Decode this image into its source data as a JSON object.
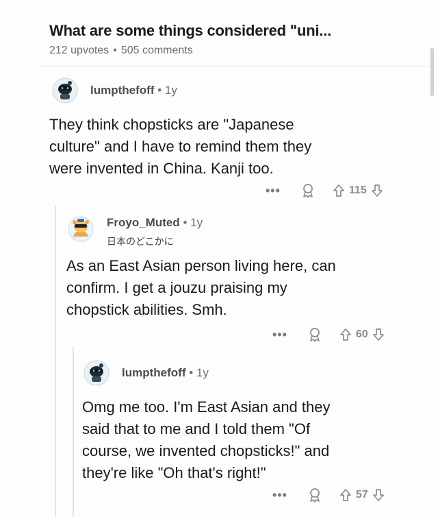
{
  "post": {
    "title": "What are some things considered \"uni...",
    "upvotes": "212 upvotes",
    "comments": "505 comments",
    "separator": "•"
  },
  "comments": [
    {
      "author": "lumpthefoff",
      "age": "1y",
      "separator": "•",
      "flair": "",
      "body": [
        "They think chopsticks are \"Japanese",
        "culture\" and I have to remind them they",
        "were invented in China.  Kanji too."
      ],
      "more": "•••",
      "score": "115"
    },
    {
      "author": "Froyo_Muted",
      "age": "1y",
      "separator": "•",
      "flair": "日本のどこかに",
      "body": [
        "As an East Asian person living here, can",
        "confirm. I get a jouzu praising my",
        "chopstick abilities. Smh."
      ],
      "more": "•••",
      "score": "60"
    },
    {
      "author": "lumpthefoff",
      "age": "1y",
      "separator": "•",
      "flair": "",
      "body": [
        "Omg me too.  I'm East Asian and they",
        "said that to me and I told them \"Of",
        "course, we invented chopsticks!\" and",
        "they're like \"Oh that's right!\""
      ],
      "more": "•••",
      "score": "57"
    }
  ],
  "icons": {
    "award": "award-icon",
    "upvote": "upvote-arrow-icon",
    "downvote": "downvote-arrow-icon",
    "more": "more-options-icon"
  },
  "colors": {
    "text": "#1a1a1b",
    "meta": "#6b6e72",
    "icon": "#8a8d91",
    "thread_line": "#e1e3e6"
  }
}
